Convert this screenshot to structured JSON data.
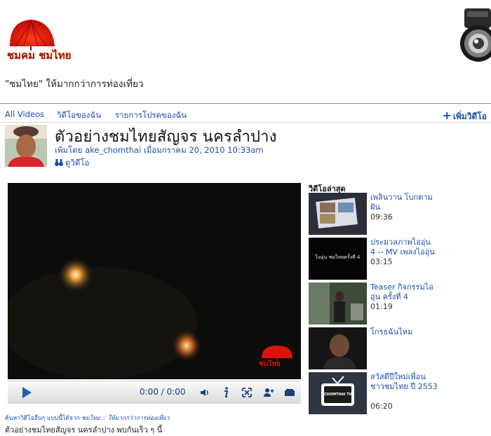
{
  "site": {
    "logo_text": "ชมคม ชมไทย",
    "tagline": "\"ชมไทย\" ให้มากกว่าการท่องเที่ยว"
  },
  "nav": {
    "all_videos": "All Videos",
    "my_videos": "วิดีโอของฉัน",
    "favorites": "รายการโปรดของฉัน",
    "add_video": "เพิ่มวิดีโอ"
  },
  "video": {
    "title": "ตัวอย่างชมไทยสัญจร  นครลำปาง",
    "byline": "เพิ่มโดย ake_chomthai เมื่อมกราคม 20, 2010 10:33am",
    "view_label": "ดูวิดีโอ",
    "time": "0:00 / 0:00",
    "watermark": "ชมไทย",
    "source_prefix": "ค้นหาวิดีโออื่นๆ แบบนี้ได้จาก ",
    "source_link": "ชมไทย :: ให้มากกว่าการท่องเที่ยว",
    "description": "ตัวอย่างชมไทยสัญจร นครลำปาง พบกันเร็ว ๆ นี้"
  },
  "latest": {
    "heading": "วิดีโอล่าสุด",
    "items": [
      {
        "title": "เพลินวาน โบกตามฝัน",
        "duration": "09:36"
      },
      {
        "title": "ประมวลภาพไออุ่น 4 -- MV เพลงไออุ่น",
        "duration": "03:15",
        "thumb_text": "ไออุ่น ชมไทยครั้งที่ 4"
      },
      {
        "title": "Teaser กิจกรรมไออุ่น ครั้งที่ 4",
        "duration": "01:19"
      },
      {
        "title": "โกรธฉันไหม",
        "duration": ""
      },
      {
        "title": "สวัสดีปีใหม่เพื่อนชาวชมไทย ปี 2553",
        "duration": "06:20",
        "thumb_text": "CHOMTHAI TV"
      }
    ]
  },
  "colors": {
    "link": "#1d4fa8",
    "logo_red": "#d9140a",
    "player_bg": "#0c0c0a"
  }
}
